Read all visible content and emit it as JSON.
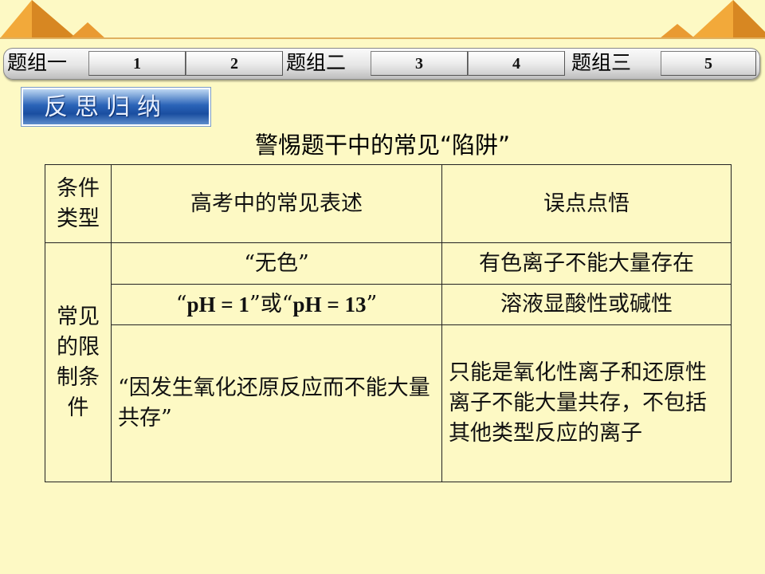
{
  "nav": {
    "groups": [
      "题组一",
      "题组二",
      "题组三"
    ],
    "buttons": [
      "1",
      "2",
      "3",
      "4",
      "5"
    ]
  },
  "banner": {
    "label": "反思归纳"
  },
  "title": "警惕题干中的常见“陷阱”",
  "table": {
    "headers": {
      "type": "条件类型",
      "expression": "高考中的常见表述",
      "insight": "误点点悟"
    },
    "group_label": "常见的限制条件",
    "rows": [
      {
        "expression": "“无色”",
        "insight": "有色离子不能大量存在"
      },
      {
        "expression_parts": [
          "“",
          "pH = 1",
          "”或“",
          "pH = 13",
          "”"
        ],
        "insight": "溶液显酸性或碱性"
      },
      {
        "expression": "“因发生氧化还原反应而不能大量共存”",
        "insight": "只能是氧化性离子和还原性离子不能大量共存，不包括其他类型反应的离子"
      }
    ]
  },
  "colors": {
    "background": "#fdf9c4",
    "deco_orange": "#f2a93a",
    "banner_blue": "#2b64b8"
  }
}
